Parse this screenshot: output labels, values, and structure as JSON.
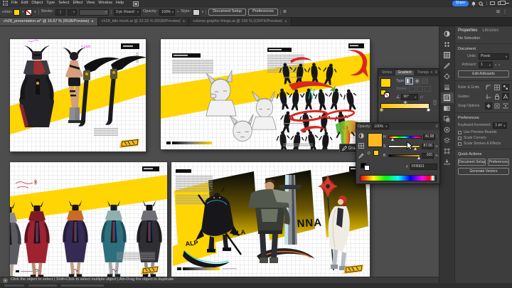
{
  "app": {
    "menu_items": [
      "File",
      "Edit",
      "Object",
      "Type",
      "Select",
      "Effect",
      "View",
      "Window",
      "Help"
    ],
    "share_label": "Share"
  },
  "icons": {
    "tab_close": "×",
    "panel_menu": "≡",
    "collapse": "»",
    "angle": "∠",
    "reverse": "⇄",
    "hash": "#"
  },
  "controlbar": {
    "context_label": "Selection",
    "stroke_label": "Stroke:",
    "brush_value": "3 pt. Round",
    "opacity_label": "Opacity:",
    "opacity_value": "100%",
    "style_label": "Style:",
    "document_setup_label": "Document Setup",
    "preferences_label": "Preferences"
  },
  "tabs": [
    {
      "title": "ch28_presentation.ai* @ 16.67 % (RGB/Preview)"
    },
    {
      "title": "ch28_title mock.ai @ 33.33 % (RGB/Preview)"
    },
    {
      "title": "colorso graphic things.ai @ 150 % (CMYK/Preview)"
    }
  ],
  "gradient_panel": {
    "tabs": [
      "Stroke",
      "Gradient",
      "Transparency"
    ],
    "type_label": "Type:",
    "stroke_label": "Stroke:",
    "angle_value": "90°"
  },
  "color_panel": {
    "opacity_label": "Opacity:",
    "opacity_value": "100%",
    "channels": [
      {
        "label": "H",
        "value": "41.08",
        "unit": "°"
      },
      {
        "label": "S",
        "value": "87.06",
        "unit": "%"
      },
      {
        "label": "B",
        "value": "100",
        "unit": "%"
      }
    ],
    "hex_value": "FFB921"
  },
  "tooltip": {
    "label": "Dra"
  },
  "properties": {
    "tabs": [
      "Properties",
      "Libraries"
    ],
    "no_selection": "No Selection",
    "document": {
      "title": "Document",
      "units_label": "Units:",
      "units_value": "Pixels",
      "artboard_label": "Artboard:",
      "artboard_value": "1",
      "edit_artboards_label": "Edit Artboards"
    },
    "ruler_grids_label": "Ruler & Grids",
    "guides_label": "Guides",
    "snap_label": "Snap Options",
    "preferences": {
      "title": "Preferences",
      "keyboard_increment_label": "Keyboard Increment:",
      "keyboard_increment_value": "1 px",
      "checkboxes": [
        "Use Preview Bounds",
        "Scale Corners",
        "Scale Strokes & Effects"
      ]
    },
    "quick_actions": {
      "title": "Quick Actions",
      "buttons": [
        "Document Setup",
        "Preferences",
        "Generate Vectors"
      ]
    }
  },
  "statusbar": {
    "hint": "Click the object to select   |   Shift+Click to select multiple object   |   Alt+Drag the object to duplicate"
  },
  "artboards": {
    "a1": {
      "annotation": "path"
    },
    "a4": {
      "names": [
        "ALP",
        "BLA",
        "ANNA"
      ]
    }
  },
  "colors": {
    "brand_yellow": "#FFD503",
    "swatch_orange": "#FFB921",
    "share_blue": "#2D7FF0",
    "red_accent": "#D82822"
  }
}
